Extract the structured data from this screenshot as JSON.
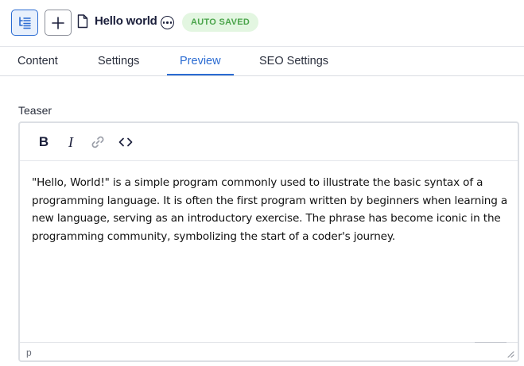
{
  "header": {
    "title": "Hello world",
    "status_badge": "AUTO SAVED",
    "icons": {
      "tree": "tree-structure-icon",
      "add": "plus-icon",
      "document": "document-icon",
      "more": "more-options-icon"
    },
    "colors": {
      "accent": "#2a6bd2",
      "badge_bg": "#e3f6e1",
      "badge_text": "#4aa44a"
    }
  },
  "tabs": [
    {
      "label": "Content",
      "active": false
    },
    {
      "label": "Settings",
      "active": false
    },
    {
      "label": "Preview",
      "active": true
    },
    {
      "label": "SEO Settings",
      "active": false
    }
  ],
  "field": {
    "label": "Teaser",
    "toolbar": {
      "bold_label": "B",
      "italic_label": "I",
      "link_icon": "link-icon",
      "code_icon": "code-icon"
    },
    "content_text": "\"Hello, World!\" is a simple program commonly used to illustrate the basic syntax of a programming language. It is often the first program written by beginners when learning a new language, serving as an introductory exercise. The phrase has become iconic in the programming community, symbolizing the start of a coder's journey.",
    "status_path": "p"
  }
}
